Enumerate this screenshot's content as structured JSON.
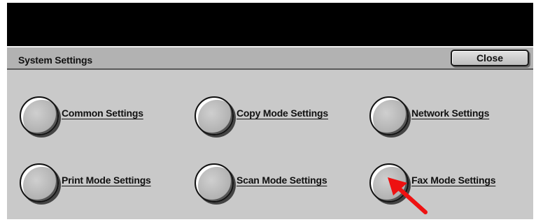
{
  "title_bar": {
    "title": "System Settings",
    "close_label": "Close"
  },
  "options": [
    {
      "id": "common",
      "label": "Common Settings"
    },
    {
      "id": "copy-mode",
      "label": "Copy Mode Settings"
    },
    {
      "id": "network",
      "label": "Network Settings"
    },
    {
      "id": "print-mode",
      "label": "Print Mode Settings"
    },
    {
      "id": "scan-mode",
      "label": "Scan Mode Settings"
    },
    {
      "id": "fax-mode",
      "label": "Fax Mode Settings"
    }
  ],
  "annotation": {
    "icon": "red-arrow-icon",
    "color": "#ee1111",
    "points_to": "fax-mode"
  },
  "colors": {
    "panel": "#c9c9c9",
    "message_area": "#000000",
    "title_bar": "#b2b2b2"
  }
}
